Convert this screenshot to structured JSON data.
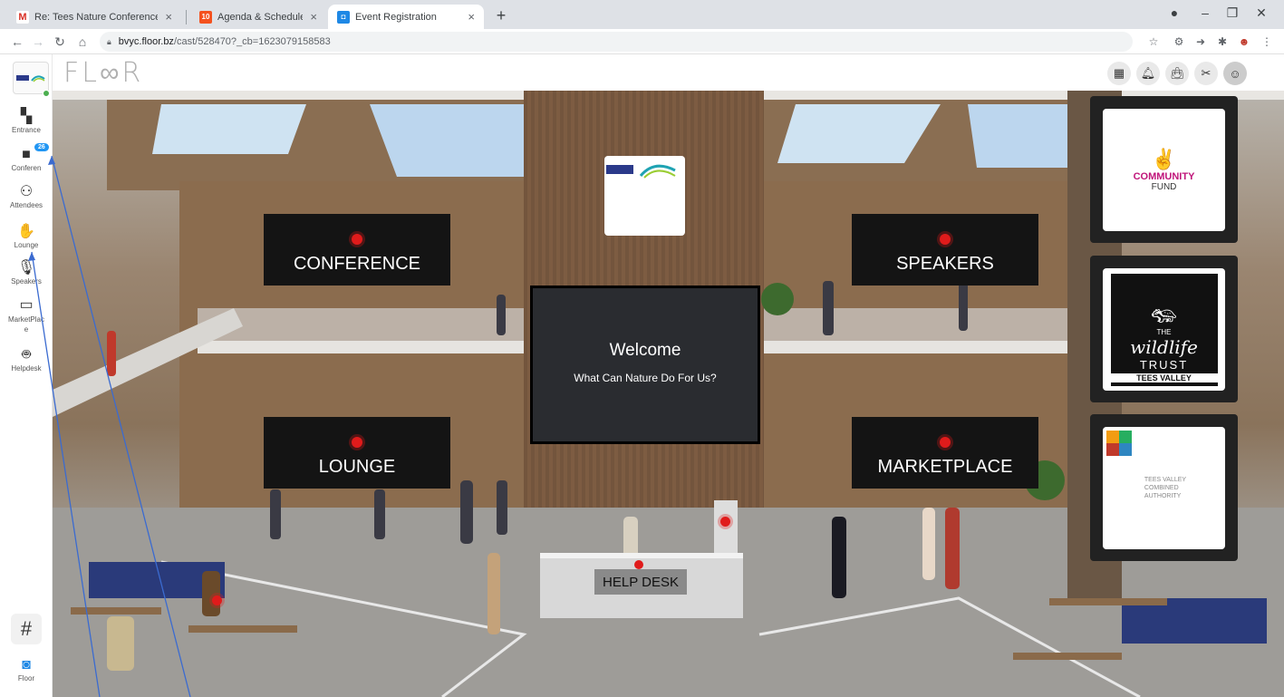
{
  "browser": {
    "tabs": [
      {
        "label": "Re: Tees Nature Conference - ma",
        "icon": "gmail-icon"
      },
      {
        "label": "Agenda & Schedule",
        "icon": "calendar-icon",
        "badge": "10"
      },
      {
        "label": "Event Registration",
        "icon": "floor-icon"
      }
    ],
    "url_host": "bvyc.floor.bz",
    "url_path": "/cast/528470?_cb=1623079158583"
  },
  "sidebar": {
    "items": [
      {
        "label": "Entrance",
        "icon": "map-icon"
      },
      {
        "label": "Conferen",
        "icon": "video-icon",
        "badge": "26"
      },
      {
        "label": "Attendees",
        "icon": "users-icon"
      },
      {
        "label": "Lounge",
        "icon": "handshake-icon"
      },
      {
        "label": "Speakers",
        "icon": "microphone-icon"
      },
      {
        "label": "MarketPlac e",
        "icon": "store-icon"
      },
      {
        "label": "Helpdesk",
        "icon": "robot-icon"
      }
    ],
    "hash_label": "#",
    "floor_label": "Floor"
  },
  "header": {
    "logo": "FL∞R"
  },
  "scene": {
    "signs": {
      "conference": "CONFERENCE",
      "speakers": "SPEAKERS",
      "lounge": "LOUNGE",
      "marketplace": "MARKETPLACE"
    },
    "welcome_title": "Welcome",
    "welcome_subtitle": "What Can Nature Do For Us?",
    "help_desk": "HELP DESK",
    "sponsors": {
      "community_1": "COMMUNITY",
      "community_2": "FUND",
      "wildlife_1": "THE",
      "wildlife_2": "wildlife",
      "wildlife_3": "TRUST",
      "wildlife_4": "TEES VALLEY",
      "tvca_1": "TEES VALLEY",
      "tvca_2": "COMBINED",
      "tvca_3": "AUTHORITY"
    }
  },
  "colors": {
    "accent_red": "#e01b1b",
    "badge_blue": "#2196f3",
    "community_pink": "#c0157a"
  }
}
